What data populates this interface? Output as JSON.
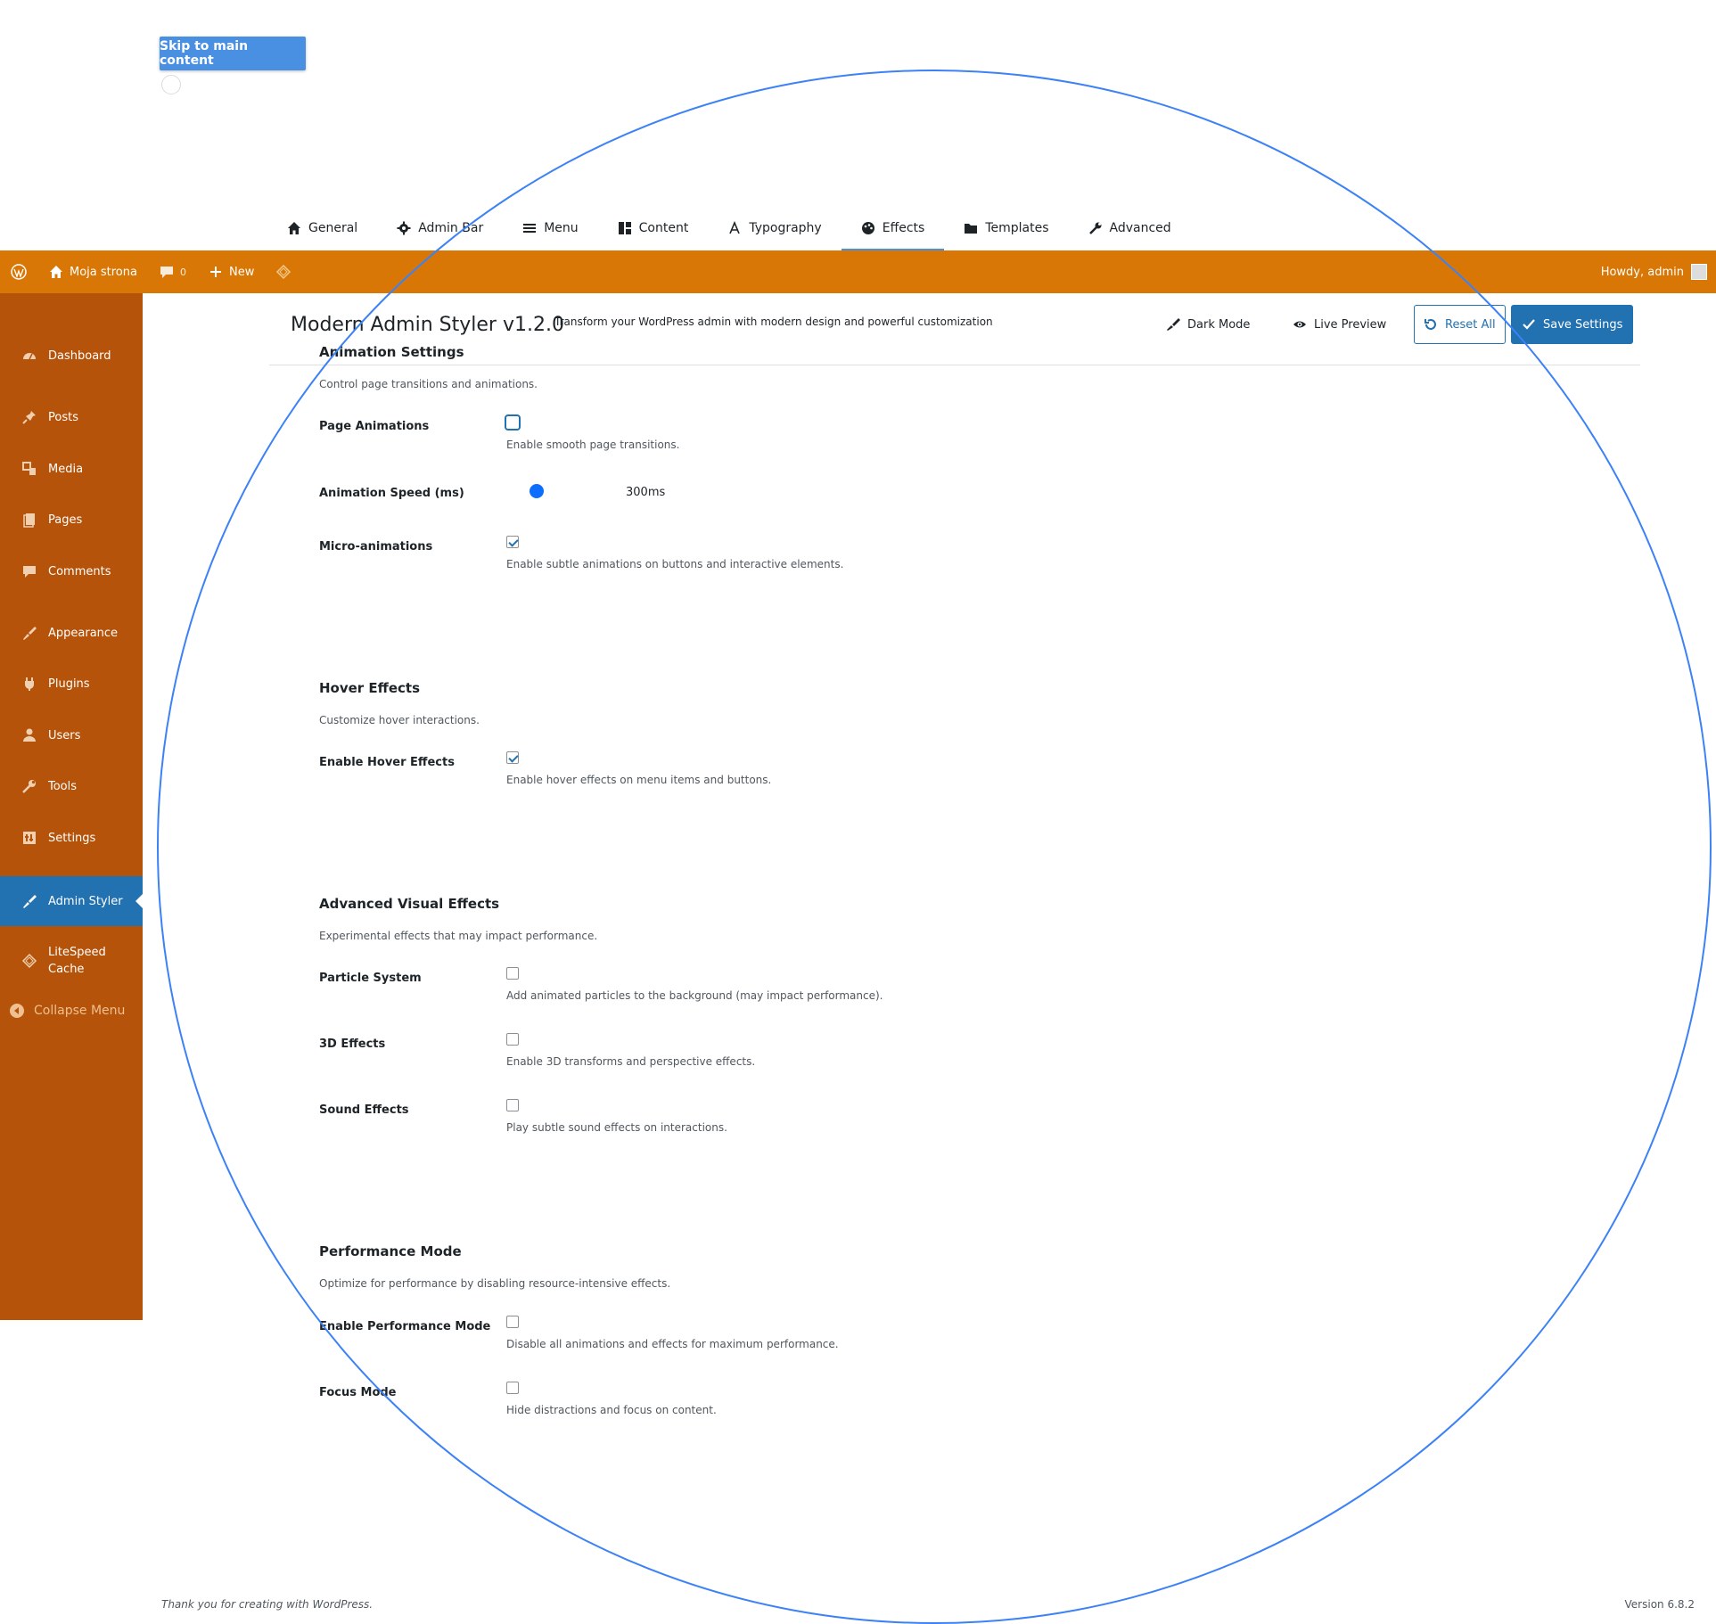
{
  "skip_link": "Skip to main content",
  "tabs": [
    {
      "label": "General",
      "icon": "home-icon"
    },
    {
      "label": "Admin Bar",
      "icon": "gear-icon"
    },
    {
      "label": "Menu",
      "icon": "menu-icon"
    },
    {
      "label": "Content",
      "icon": "grid-icon"
    },
    {
      "label": "Typography",
      "icon": "text-icon"
    },
    {
      "label": "Effects",
      "icon": "palette-icon",
      "active": true
    },
    {
      "label": "Templates",
      "icon": "folder-icon"
    },
    {
      "label": "Advanced",
      "icon": "wrench-icon"
    }
  ],
  "adminbar": {
    "site_name": "Moja strona",
    "comments_count": "0",
    "new_label": "New",
    "greeting": "Howdy, admin"
  },
  "sidebar": {
    "items": [
      {
        "label": "Dashboard",
        "icon": "dashboard-icon"
      },
      {
        "label": "Posts",
        "icon": "pin-icon"
      },
      {
        "label": "Media",
        "icon": "media-icon"
      },
      {
        "label": "Pages",
        "icon": "pages-icon"
      },
      {
        "label": "Comments",
        "icon": "comment-icon"
      },
      {
        "label": "Appearance",
        "icon": "brush-icon"
      },
      {
        "label": "Plugins",
        "icon": "plug-icon"
      },
      {
        "label": "Users",
        "icon": "user-icon"
      },
      {
        "label": "Tools",
        "icon": "wrench-icon"
      },
      {
        "label": "Settings",
        "icon": "settings-icon"
      },
      {
        "label": "Admin Styler",
        "icon": "brush-icon",
        "current": true
      },
      {
        "label": "LiteSpeed Cache",
        "icon": "diamond-icon"
      }
    ],
    "collapse": "Collapse Menu"
  },
  "header": {
    "title": "Modern Admin Styler v1.2.0",
    "subtitle": "Transform your WordPress admin with modern design and powerful customization",
    "dark_mode": "Dark Mode",
    "live_preview": "Live Preview",
    "reset": "Reset All",
    "save": "Save Settings"
  },
  "sections": {
    "animation": {
      "title": "Animation Settings",
      "desc": "Control page transitions and animations.",
      "page_animations": {
        "label": "Page Animations",
        "help": "Enable smooth page transitions.",
        "checked": false
      },
      "speed": {
        "label": "Animation Speed (ms)",
        "value": "300ms"
      },
      "micro": {
        "label": "Micro-animations",
        "help": "Enable subtle animations on buttons and interactive elements.",
        "checked": true
      }
    },
    "hover": {
      "title": "Hover Effects",
      "desc": "Customize hover interactions.",
      "enable": {
        "label": "Enable Hover Effects",
        "help": "Enable hover effects on menu items and buttons.",
        "checked": true
      }
    },
    "advanced": {
      "title": "Advanced Visual Effects",
      "desc": "Experimental effects that may impact performance.",
      "particles": {
        "label": "Particle System",
        "help": "Add animated particles to the background (may impact performance).",
        "checked": false
      },
      "threed": {
        "label": "3D Effects",
        "help": "Enable 3D transforms and perspective effects.",
        "checked": false
      },
      "sound": {
        "label": "Sound Effects",
        "help": "Play subtle sound effects on interactions.",
        "checked": false
      }
    },
    "performance": {
      "title": "Performance Mode",
      "desc": "Optimize for performance by disabling resource-intensive effects.",
      "enable": {
        "label": "Enable Performance Mode",
        "help": "Disable all animations and effects for maximum performance.",
        "checked": false
      },
      "focus": {
        "label": "Focus Mode",
        "help": "Hide distractions and focus on content.",
        "checked": false
      }
    }
  },
  "footer": {
    "thanks": "Thank you for creating with WordPress.",
    "version": "Version 6.8.2"
  },
  "colors": {
    "adminbar": "#d97706",
    "sidebar": "#b45309",
    "accent": "#2271b1",
    "tab_underline": "#4a90e2",
    "overlay_circle": "#3c82f6"
  }
}
